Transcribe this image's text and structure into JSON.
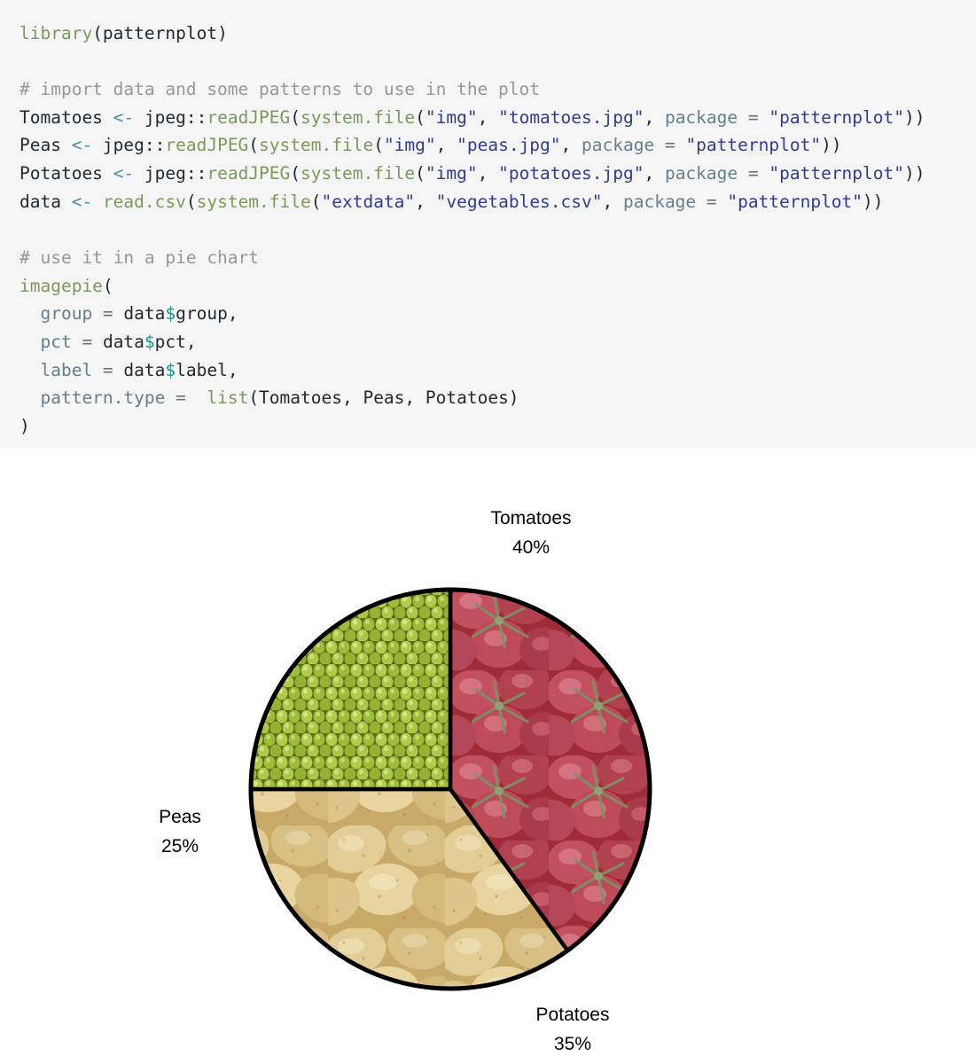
{
  "code": {
    "language": "r",
    "background": "#f5f5f5",
    "lines": [
      [
        {
          "t": "library",
          "c": "fn"
        },
        {
          "t": "(patternplot)",
          "c": "pl"
        }
      ],
      [],
      [
        {
          "t": "# import data and some patterns to use in the plot",
          "c": "cm"
        }
      ],
      [
        {
          "t": "Tomatoes ",
          "c": "pl"
        },
        {
          "t": "<-",
          "c": "op"
        },
        {
          "t": " jpeg::",
          "c": "pl"
        },
        {
          "t": "readJPEG",
          "c": "fn"
        },
        {
          "t": "(",
          "c": "pl"
        },
        {
          "t": "system.file",
          "c": "fn"
        },
        {
          "t": "(",
          "c": "pl"
        },
        {
          "t": "\"img\"",
          "c": "str"
        },
        {
          "t": ", ",
          "c": "pl"
        },
        {
          "t": "\"tomatoes.jpg\"",
          "c": "str"
        },
        {
          "t": ", ",
          "c": "pl"
        },
        {
          "t": "package",
          "c": "arg"
        },
        {
          "t": " = ",
          "c": "eq"
        },
        {
          "t": "\"patternplot\"",
          "c": "str"
        },
        {
          "t": "))",
          "c": "pl"
        }
      ],
      [
        {
          "t": "Peas ",
          "c": "pl"
        },
        {
          "t": "<-",
          "c": "op"
        },
        {
          "t": " jpeg::",
          "c": "pl"
        },
        {
          "t": "readJPEG",
          "c": "fn"
        },
        {
          "t": "(",
          "c": "pl"
        },
        {
          "t": "system.file",
          "c": "fn"
        },
        {
          "t": "(",
          "c": "pl"
        },
        {
          "t": "\"img\"",
          "c": "str"
        },
        {
          "t": ", ",
          "c": "pl"
        },
        {
          "t": "\"peas.jpg\"",
          "c": "str"
        },
        {
          "t": ", ",
          "c": "pl"
        },
        {
          "t": "package",
          "c": "arg"
        },
        {
          "t": " = ",
          "c": "eq"
        },
        {
          "t": "\"patternplot\"",
          "c": "str"
        },
        {
          "t": "))",
          "c": "pl"
        }
      ],
      [
        {
          "t": "Potatoes ",
          "c": "pl"
        },
        {
          "t": "<-",
          "c": "op"
        },
        {
          "t": " jpeg::",
          "c": "pl"
        },
        {
          "t": "readJPEG",
          "c": "fn"
        },
        {
          "t": "(",
          "c": "pl"
        },
        {
          "t": "system.file",
          "c": "fn"
        },
        {
          "t": "(",
          "c": "pl"
        },
        {
          "t": "\"img\"",
          "c": "str"
        },
        {
          "t": ", ",
          "c": "pl"
        },
        {
          "t": "\"potatoes.jpg\"",
          "c": "str"
        },
        {
          "t": ", ",
          "c": "pl"
        },
        {
          "t": "package",
          "c": "arg"
        },
        {
          "t": " = ",
          "c": "eq"
        },
        {
          "t": "\"patternplot\"",
          "c": "str"
        },
        {
          "t": "))",
          "c": "pl"
        }
      ],
      [
        {
          "t": "data ",
          "c": "pl"
        },
        {
          "t": "<-",
          "c": "op"
        },
        {
          "t": " ",
          "c": "pl"
        },
        {
          "t": "read.csv",
          "c": "fn"
        },
        {
          "t": "(",
          "c": "pl"
        },
        {
          "t": "system.file",
          "c": "fn"
        },
        {
          "t": "(",
          "c": "pl"
        },
        {
          "t": "\"extdata\"",
          "c": "str"
        },
        {
          "t": ", ",
          "c": "pl"
        },
        {
          "t": "\"vegetables.csv\"",
          "c": "str"
        },
        {
          "t": ", ",
          "c": "pl"
        },
        {
          "t": "package",
          "c": "arg"
        },
        {
          "t": " = ",
          "c": "eq"
        },
        {
          "t": "\"patternplot\"",
          "c": "str"
        },
        {
          "t": "))",
          "c": "pl"
        }
      ],
      [],
      [
        {
          "t": "# use it in a pie chart",
          "c": "cm"
        }
      ],
      [
        {
          "t": "imagepie",
          "c": "fn"
        },
        {
          "t": "(",
          "c": "pl"
        }
      ],
      [
        {
          "t": "  ",
          "c": "pl"
        },
        {
          "t": "group",
          "c": "arg"
        },
        {
          "t": " = ",
          "c": "eq"
        },
        {
          "t": "data",
          "c": "pl"
        },
        {
          "t": "$",
          "c": "dl"
        },
        {
          "t": "group,",
          "c": "pl"
        }
      ],
      [
        {
          "t": "  ",
          "c": "pl"
        },
        {
          "t": "pct",
          "c": "arg"
        },
        {
          "t": " = ",
          "c": "eq"
        },
        {
          "t": "data",
          "c": "pl"
        },
        {
          "t": "$",
          "c": "dl"
        },
        {
          "t": "pct,",
          "c": "pl"
        }
      ],
      [
        {
          "t": "  ",
          "c": "pl"
        },
        {
          "t": "label",
          "c": "arg"
        },
        {
          "t": " = ",
          "c": "eq"
        },
        {
          "t": "data",
          "c": "pl"
        },
        {
          "t": "$",
          "c": "dl"
        },
        {
          "t": "label,",
          "c": "pl"
        }
      ],
      [
        {
          "t": "  ",
          "c": "pl"
        },
        {
          "t": "pattern.type",
          "c": "arg"
        },
        {
          "t": " =  ",
          "c": "eq"
        },
        {
          "t": "list",
          "c": "fn"
        },
        {
          "t": "(Tomatoes, Peas, Potatoes)",
          "c": "pl"
        }
      ],
      [
        {
          "t": ")",
          "c": "pl"
        }
      ]
    ]
  },
  "chart_data": {
    "type": "pie",
    "title": "",
    "subtitle": "",
    "xlabel": "",
    "ylabel": "",
    "legend_position": "none",
    "grid": false,
    "start_angle_deg": 0,
    "direction": "clockwise",
    "categories": [
      "Tomatoes",
      "Peas",
      "Potatoes"
    ],
    "values": [
      40,
      25,
      35
    ],
    "labels": [
      "Tomatoes\n40%",
      "Peas\n25%",
      "Potatoes\n35%"
    ],
    "slices": [
      {
        "name": "Tomatoes",
        "pct": 40,
        "pct_text": "40%",
        "label_text": "Tomatoes",
        "fill": "image",
        "image_name": "tomatoes.jpg",
        "start_deg": 0,
        "end_deg": 144,
        "label_position": "top",
        "swatch": "#b8414e"
      },
      {
        "name": "Potatoes",
        "pct": 35,
        "pct_text": "35%",
        "label_text": "Potatoes",
        "fill": "image",
        "image_name": "potatoes.jpg",
        "start_deg": 144,
        "end_deg": 270,
        "label_position": "bottom",
        "swatch": "#ddc183"
      },
      {
        "name": "Peas",
        "pct": 25,
        "pct_text": "25%",
        "label_text": "Peas",
        "fill": "image",
        "image_name": "peas.jpg",
        "start_deg": 270,
        "end_deg": 360,
        "label_position": "left",
        "swatch": "#9aba42"
      }
    ],
    "border_color": "#000000",
    "border_width": 4,
    "background": "#ffffff"
  },
  "pie_labels": {
    "tomatoes": {
      "name": "Tomatoes",
      "pct": "40%"
    },
    "peas": {
      "name": "Peas",
      "pct": "25%"
    },
    "potatoes": {
      "name": "Potatoes",
      "pct": "35%"
    }
  }
}
